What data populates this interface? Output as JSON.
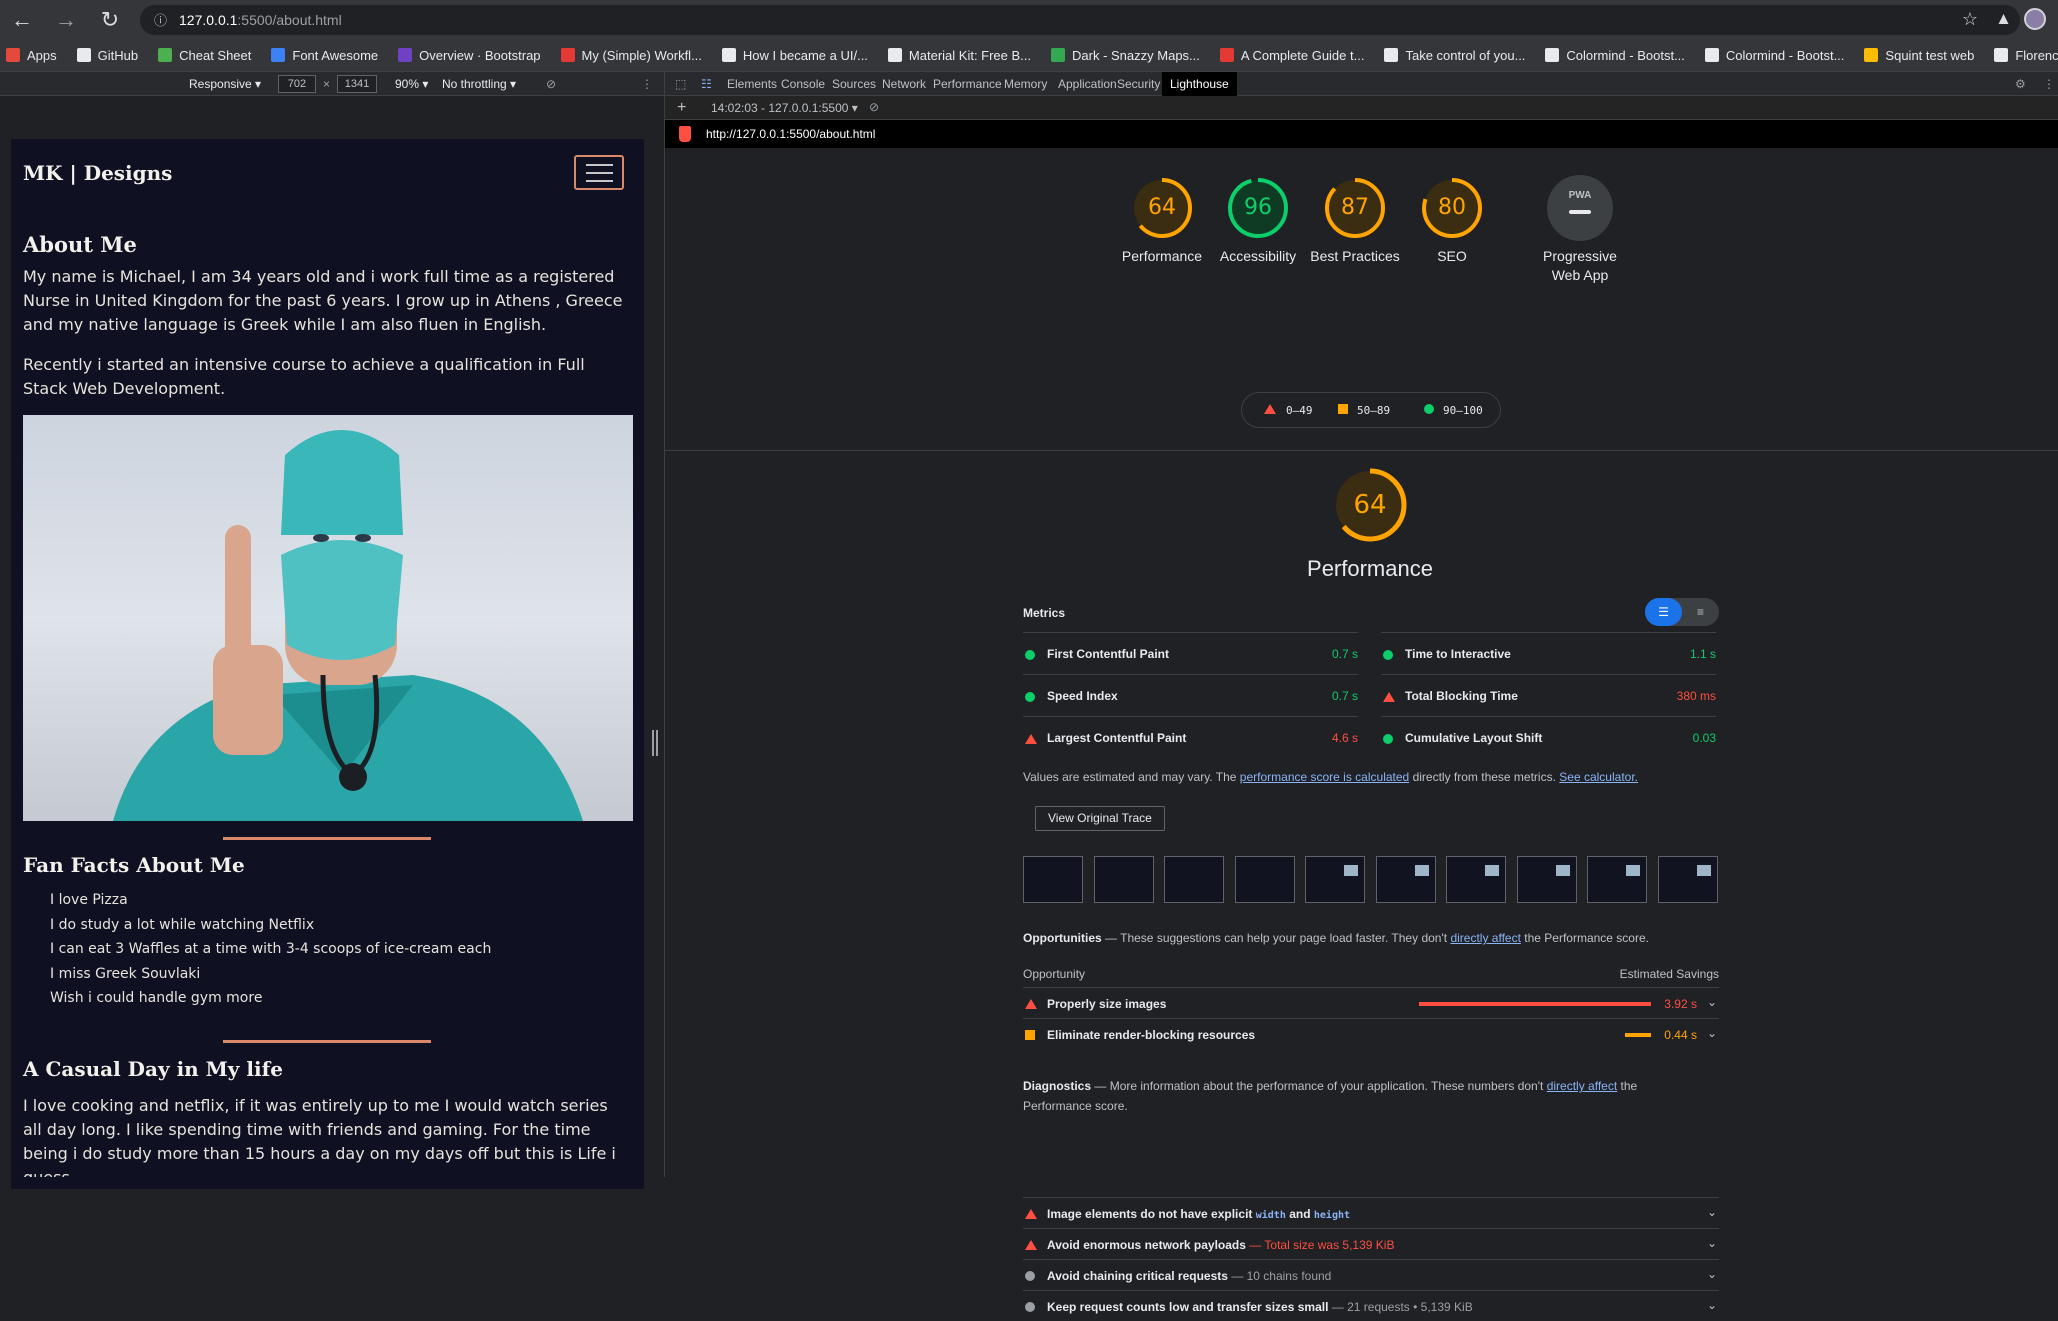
{
  "browser": {
    "url_host": "127.0.0.1",
    "url_path": ":5500/about.html",
    "bookmarks": [
      "Apps",
      "GitHub",
      "Cheat Sheet",
      "Font Awesome",
      "Overview · Bootstrap",
      "My (Simple) Workfl...",
      "How I became a UI/...",
      "Material Kit: Free B...",
      "Dark - Snazzy Maps...",
      "A Complete Guide t...",
      "Take control of you...",
      "Colormind - Bootst...",
      "Colormind - Bootst...",
      "Squint test web",
      "Florence Nightenga..."
    ]
  },
  "device_toolbar": {
    "mode": "Responsive",
    "width": "702",
    "height": "1341",
    "zoom": "90%",
    "throttling": "No throttling"
  },
  "site": {
    "brand": "MK | Designs",
    "about_title": "About Me",
    "about_p1": "My name is Michael, I am 34 years old and i work full time as a registered Nurse in United Kingdom for the past 6 years. I grow up in Athens , Greece and my native language is Greek while I am also fluen in English.",
    "about_p2": "Recently i started an intensive course to achieve a qualification in Full Stack Web Development.",
    "facts_title": "Fan Facts About Me",
    "facts": [
      "I love Pizza",
      "I do study a lot while watching Netflix",
      "I can eat 3 Waffles at a time with 3-4 scoops of ice-cream each",
      "I miss Greek Souvlaki",
      "Wish i could handle gym more"
    ],
    "day_title": "A Casual Day in My life",
    "day_p": "I love cooking and netflix, if it was entirely up to me I would watch series all day long. I like spending time with friends and gaming. For the time being i do study more than 15 hours a day on my days off but this is Life i guess."
  },
  "devtools": {
    "tabs": [
      "Elements",
      "Console",
      "Sources",
      "Network",
      "Performance",
      "Memory",
      "Application",
      "Security",
      "Lighthouse"
    ],
    "active_tab": "Lighthouse",
    "report_select": "14:02:03 - 127.0.0.1:5500",
    "report_url": "http://127.0.0.1:5500/about.html"
  },
  "lighthouse": {
    "gauges": [
      {
        "score": "64",
        "label": "Performance",
        "fraction": 0.64,
        "color": "#ffa400"
      },
      {
        "score": "96",
        "label": "Accessibility",
        "fraction": 0.96,
        "color": "#0cce6b"
      },
      {
        "score": "87",
        "label": "Best Practices",
        "fraction": 0.87,
        "color": "#ffa400"
      },
      {
        "score": "80",
        "label": "SEO",
        "fraction": 0.8,
        "color": "#ffa400"
      }
    ],
    "pwa_label": "Progressive Web App",
    "pwa_badge": "PWA",
    "legend": {
      "fail": "0–49",
      "average": "50–89",
      "pass": "90–100"
    },
    "perf_score": "64",
    "perf_title": "Performance",
    "metrics_title": "Metrics",
    "metrics": [
      {
        "name": "First Contentful Paint",
        "value": "0.7 s",
        "status": "pass"
      },
      {
        "name": "Time to Interactive",
        "value": "1.1 s",
        "status": "pass"
      },
      {
        "name": "Speed Index",
        "value": "0.7 s",
        "status": "pass"
      },
      {
        "name": "Total Blocking Time",
        "value": "380 ms",
        "status": "fail"
      },
      {
        "name": "Largest Contentful Paint",
        "value": "4.6 s",
        "status": "fail"
      },
      {
        "name": "Cumulative Layout Shift",
        "value": "0.03",
        "status": "pass"
      }
    ],
    "note_pre": "Values are estimated and may vary. The",
    "note_link1": "performance score is calculated",
    "note_mid": "directly from these metrics.",
    "note_link2": "See calculator.",
    "trace_button": "View Original Trace",
    "opps_title": "Opportunities",
    "opps_desc_pre": "— These suggestions can help your page load faster. They don't",
    "opps_link": "directly affect",
    "opps_desc_post": "the Performance score.",
    "col_opportunity": "Opportunity",
    "col_savings": "Estimated Savings",
    "opportunities": [
      {
        "name": "Properly size images",
        "savings": "3.92 s",
        "status": "fail",
        "fraction": 1.0
      },
      {
        "name": "Eliminate render-blocking resources",
        "savings": "0.44 s",
        "status": "average",
        "fraction": 0.11
      }
    ],
    "diag_title": "Diagnostics",
    "diag_desc_pre": "— More information about the performance of your application. These numbers don't",
    "diag_link": "directly affect",
    "diag_desc_post": "the Performance score.",
    "diagnostics": [
      {
        "name": "Image elements do not have explicit",
        "code1": "width",
        "and": "and",
        "code2": "height",
        "status": "fail"
      },
      {
        "name": "Avoid enormous network payloads",
        "detail": "— Total size was 5,139 KiB",
        "status": "fail"
      },
      {
        "name": "Avoid chaining critical requests",
        "detail": "— 10 chains found",
        "status": "info"
      },
      {
        "name": "Keep request counts low and transfer sizes small",
        "detail": "— 21 requests • 5,139 KiB",
        "status": "info"
      }
    ]
  }
}
